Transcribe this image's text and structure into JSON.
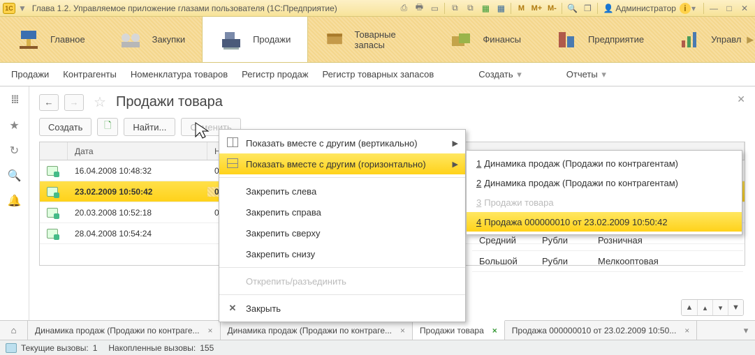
{
  "titlebar": {
    "logo_text": "1C",
    "title": "Глава 1.2. Управляемое приложение глазами пользователя  (1С:Предприятие)",
    "user": "Администратор",
    "m1": "M",
    "m2": "M+",
    "m3": "M-"
  },
  "topnav": {
    "items": [
      {
        "label": "Главное"
      },
      {
        "label": "Закупки"
      },
      {
        "label": "Продажи"
      },
      {
        "label": "Товарные запасы"
      },
      {
        "label": "Финансы"
      },
      {
        "label": "Предприятие"
      },
      {
        "label": "Управл"
      }
    ]
  },
  "subbar": {
    "items": [
      "Продажи",
      "Контрагенты",
      "Номенклатура товаров",
      "Регистр продаж",
      "Регистр товарных запасов"
    ],
    "create": "Создать",
    "reports": "Отчеты"
  },
  "page": {
    "title": "Продажи товара",
    "create": "Создать",
    "find": "Найти...",
    "cancel": "Отменить"
  },
  "grid": {
    "headers": {
      "date": "Дата",
      "num": "Номер"
    },
    "rows": [
      {
        "date": "16.04.2008 10:48:32",
        "num": "0000"
      },
      {
        "date": "23.02.2009 10:50:42",
        "num": "0000"
      },
      {
        "date": "20.03.2008 10:52:18",
        "num": "0000"
      },
      {
        "date": "28.04.2008 10:54:24",
        "num": ""
      }
    ],
    "ext": [
      {
        "c1": "Средний",
        "c2": "Рубли",
        "c3": "Розничная"
      },
      {
        "c1": "Большой",
        "c2": "Рубли",
        "c3": "Мелкооптовая"
      }
    ]
  },
  "ctx": {
    "show_v": "Показать вместе с другим (вертикально)",
    "show_h": "Показать вместе с другим (горизонтально)",
    "pin_l": "Закрепить слева",
    "pin_r": "Закрепить справа",
    "pin_t": "Закрепить сверху",
    "pin_b": "Закрепить снизу",
    "unpin": "Открепить/разъединить",
    "close": "Закрыть"
  },
  "submenu": {
    "items": [
      {
        "n": "1",
        "label": "Динамика продаж (Продажи по контрагентам)"
      },
      {
        "n": "2",
        "label": "Динамика продаж (Продажи по контрагентам)"
      },
      {
        "n": "3",
        "label": "Продажи товара"
      },
      {
        "n": "4",
        "label": "Продажа 000000010 от 23.02.2009 10:50:42"
      }
    ]
  },
  "tabs": {
    "items": [
      "Динамика продаж (Продажи по контраге...",
      "Динамика продаж (Продажи по контраге...",
      "Продажи товара",
      "Продажа 000000010 от 23.02.2009 10:50..."
    ]
  },
  "status": {
    "calls_label": "Текущие вызовы:",
    "calls": "1",
    "acc_label": "Накопленные вызовы:",
    "acc": "155"
  }
}
